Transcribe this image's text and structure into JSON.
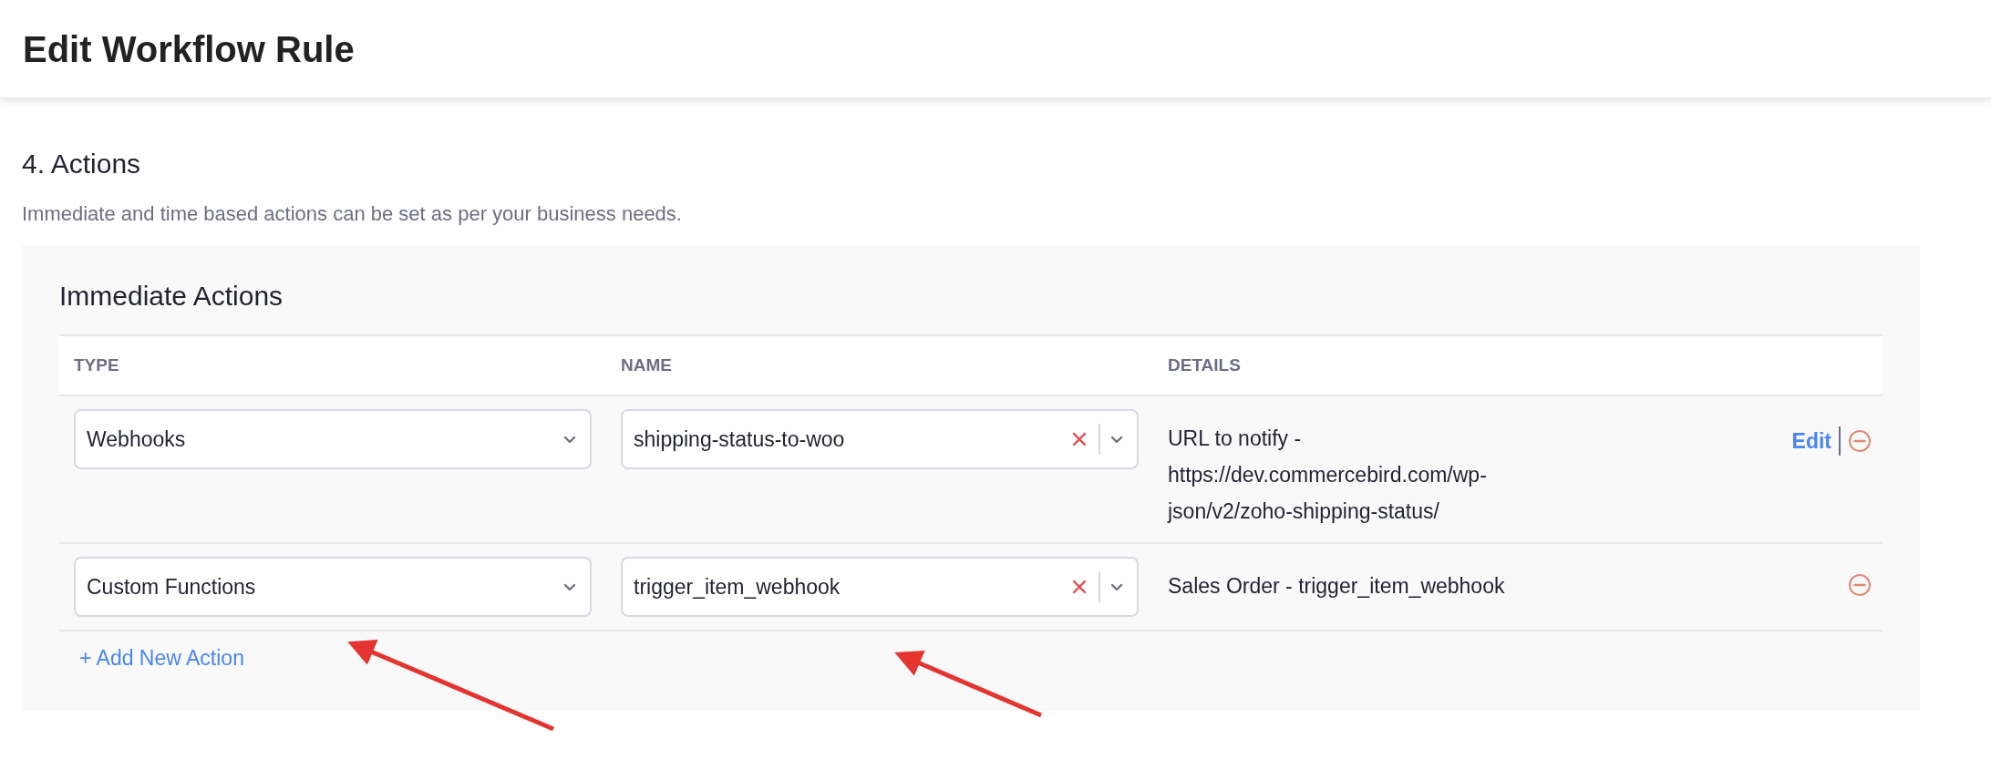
{
  "header": {
    "title": "Edit Workflow Rule"
  },
  "section": {
    "title": "4. Actions",
    "description": "Immediate and time based actions can be set as per your business needs."
  },
  "panel": {
    "title": "Immediate Actions",
    "columns": [
      "TYPE",
      "NAME",
      "DETAILS"
    ],
    "rows": [
      {
        "type": "Webhooks",
        "name": "shipping-status-to-woo",
        "details": "URL to notify - https://dev.commercebird.com/wp-json/v2/zoho-shipping-status/",
        "editable": true,
        "edit_label": "Edit"
      },
      {
        "type": "Custom Functions",
        "name": "trigger_item_webhook",
        "details": "Sales Order - trigger_item_webhook",
        "editable": false
      }
    ],
    "add_label": "+ Add New Action"
  }
}
